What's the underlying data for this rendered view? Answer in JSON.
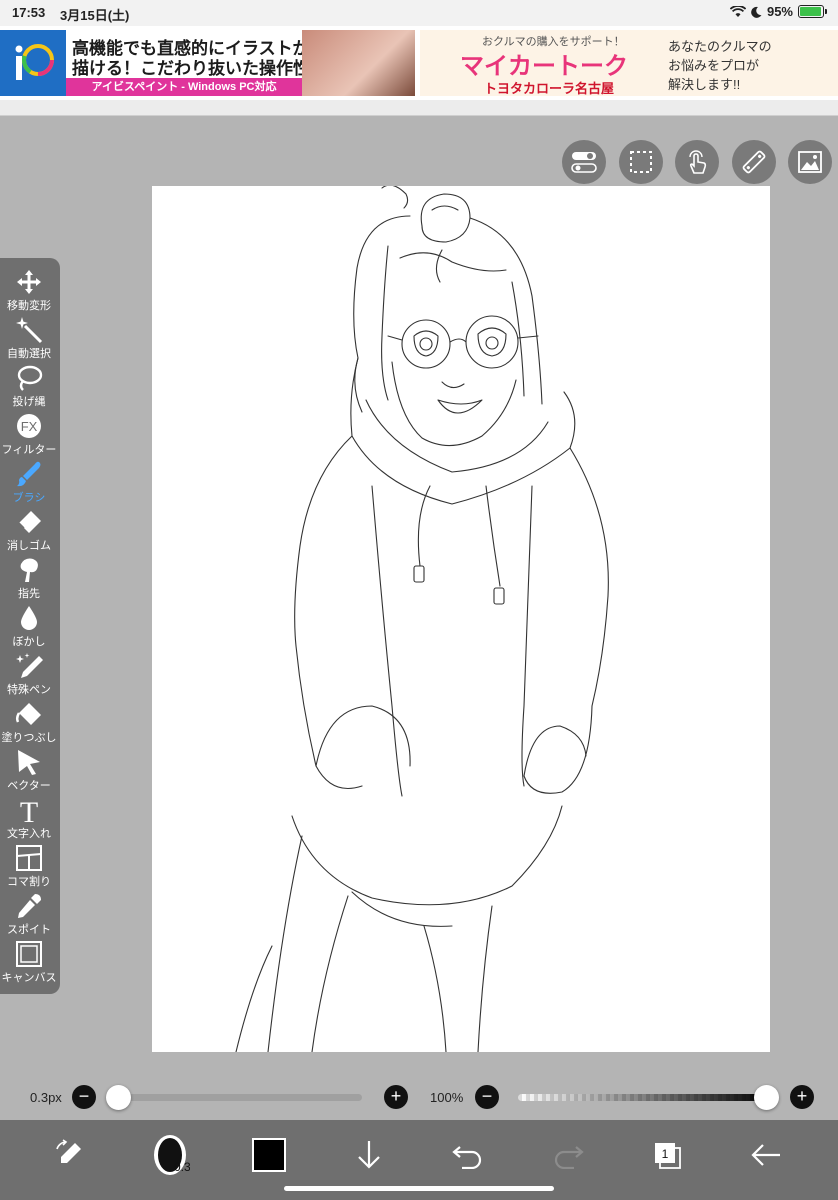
{
  "status_bar": {
    "time": "17:53",
    "date": "3月15日(土)",
    "battery": "95%"
  },
  "ad": {
    "left_line1": "高機能でも直感的にイラストが",
    "left_line2": "描ける！こだわり抜いた操作性！",
    "left_line3": "アイビスペイント - Windows PC対応",
    "right_small": "おクルマの購入をサポート！",
    "right_title": "マイカートーク",
    "right_brand": "トヨタカローラ名古屋",
    "right_copy1": "あなたのクルマの",
    "right_copy2": "お悩みをプロが",
    "right_copy3": "解決します!!"
  },
  "top_tools": [
    {
      "name": "toggle-icon"
    },
    {
      "name": "selection-icon"
    },
    {
      "name": "touch-icon"
    },
    {
      "name": "ruler-icon"
    },
    {
      "name": "image-icon"
    }
  ],
  "toolbar": {
    "items": [
      {
        "label": "移動変形",
        "icon": "move-icon"
      },
      {
        "label": "自動選択",
        "icon": "magic-wand-icon"
      },
      {
        "label": "投げ縄",
        "icon": "lasso-icon"
      },
      {
        "label": "フィルター",
        "icon": "fx-icon"
      },
      {
        "label": "ブラシ",
        "icon": "brush-icon"
      },
      {
        "label": "消しゴム",
        "icon": "eraser-icon"
      },
      {
        "label": "指先",
        "icon": "smudge-icon"
      },
      {
        "label": "ぼかし",
        "icon": "blur-icon"
      },
      {
        "label": "特殊ペン",
        "icon": "special-pen-icon"
      },
      {
        "label": "塗りつぶし",
        "icon": "fill-icon"
      },
      {
        "label": "ベクター",
        "icon": "vector-icon"
      },
      {
        "label": "文字入れ",
        "icon": "text-icon"
      },
      {
        "label": "コマ割り",
        "icon": "frame-divider-icon"
      },
      {
        "label": "スポイト",
        "icon": "eyedropper-icon"
      },
      {
        "label": "キャンバス",
        "icon": "canvas-icon"
      }
    ],
    "active_index": 4,
    "fx_text": "FX",
    "text_tool_glyph": "T"
  },
  "sliders": {
    "brush_size": "0.3px",
    "opacity": "100%",
    "brush_size_fraction": 0.0,
    "opacity_fraction": 1.0,
    "minus": "−",
    "plus": "+"
  },
  "bottom_bar": {
    "brush_size_badge": "0.3",
    "layer_count": "1",
    "color": "#000000"
  },
  "colors": {
    "active_tool": "#4aa8ff",
    "toolbar_bg": "#6f6f6f",
    "workspace_bg": "#b4b4b4"
  }
}
